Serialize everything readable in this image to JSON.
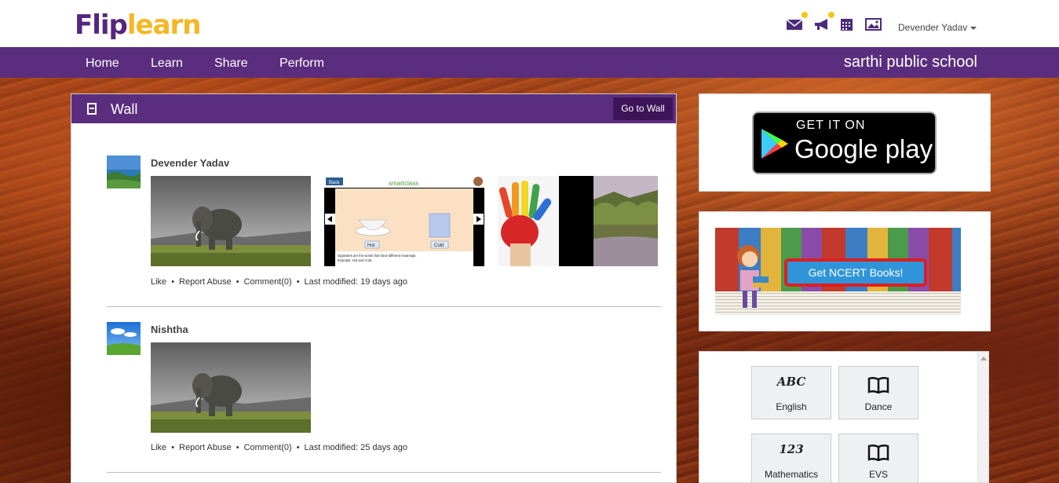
{
  "header": {
    "logo_flip": "Flip",
    "logo_learn": "learn",
    "user_name": "Devender Yadav",
    "icons": [
      "mail-icon",
      "megaphone-icon",
      "calendar-icon",
      "gallery-icon"
    ]
  },
  "nav": {
    "items": [
      {
        "label": "Home"
      },
      {
        "label": "Learn"
      },
      {
        "label": "Share"
      },
      {
        "label": "Perform"
      }
    ],
    "school": "sarthi public school"
  },
  "wall": {
    "title": "Wall",
    "go_button": "Go to Wall",
    "posts": [
      {
        "author": "Devender Yadav",
        "images": [
          "elephant-photo",
          "smartclass-hot-cold-slide",
          "painted-hand-photo",
          "lake-palm-trees-photo"
        ],
        "actions": {
          "like": "Like",
          "report": "Report Abuse",
          "comment": "Comment(0)",
          "modified": "Last modified: 19 days ago"
        }
      },
      {
        "author": "Nishtha",
        "images": [
          "elephant-photo"
        ],
        "actions": {
          "like": "Like",
          "report": "Report Abuse",
          "comment": "Comment(0)",
          "modified": "Last modified: 25 days ago"
        }
      }
    ],
    "slide": {
      "back": "Back",
      "brand": "smartclass",
      "hot": "Hot",
      "cold": "Cold",
      "caption": "Opposites are the words that have different meanings.",
      "example": "Example: Hot and Cold"
    }
  },
  "sidebar": {
    "google_play_top": "GET IT ON",
    "google_play_main": "Google play",
    "ncert_button": "Get NCERT Books!",
    "subjects": [
      {
        "label": "English",
        "icon": "abc-icon",
        "glyph": "ABC"
      },
      {
        "label": "Dance",
        "icon": "book-icon",
        "glyph": "📖"
      },
      {
        "label": "Mathematics",
        "icon": "numbers-icon",
        "glyph": "123"
      },
      {
        "label": "EVS",
        "icon": "book-icon",
        "glyph": "📖"
      }
    ]
  },
  "colors": {
    "brand_purple": "#5b2d7e",
    "logo_yellow": "#f7b625",
    "dark_purple": "#3e1459",
    "notif_dot": "#f5c518"
  }
}
